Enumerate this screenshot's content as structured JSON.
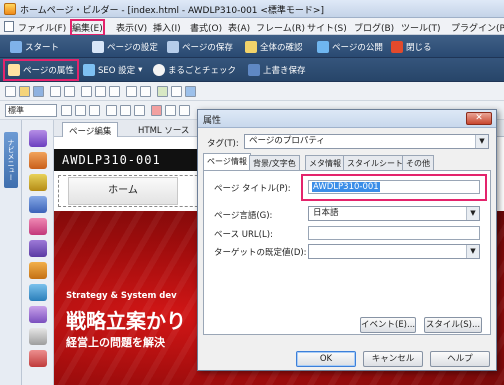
{
  "window": {
    "title": "ホームページ・ビルダー - [index.html - AWDLP310-001 <標準モード>]"
  },
  "menubar": {
    "items": [
      "ファイル(F)",
      "編集(E)",
      "表示(V)",
      "挿入(I)",
      "書式(O)",
      "表(A)",
      "フレーム(R)",
      "サイト(S)",
      "ブログ(B)",
      "ツール(T)",
      "プラグイン(P)"
    ]
  },
  "toolbar_main": {
    "start": "スタート",
    "page_settings": "ページの設定",
    "save_page": "ページの保存",
    "check_all": "全体の確認",
    "publish": "ページの公開",
    "close": "閉じる"
  },
  "toolbar_second": {
    "page_props": "ページの属性",
    "seo": "SEO 設定",
    "full_check": "まるごとチェック",
    "overwrite_save": "上書き保存"
  },
  "format_bar": {
    "style_value": "標準"
  },
  "left_panel": {
    "vertical_tab": "ナビメニュー"
  },
  "editor": {
    "tabs": [
      "ページ編集",
      "HTML ソース"
    ]
  },
  "page": {
    "logo": "AWDLP310-001",
    "nav_home": "ホーム",
    "hero_sub": "Strategy & System dev",
    "hero_main": "戦略立案かり",
    "hero_lead": "経営上の問題を解決"
  },
  "dialog": {
    "title": "属性",
    "close_glyph": "✕",
    "tag_label": "タグ(T):",
    "tag_value": "ページのプロパティ",
    "tabs": [
      "ページ情報",
      "背景/文字色",
      "メタ情報",
      "スタイルシート",
      "その他"
    ],
    "fields": {
      "page_title_label": "ページ タイトル(P):",
      "page_title_value": "AWDLP310-001",
      "language_label": "ページ言語(G):",
      "language_value": "日本語",
      "base_url_label": "ベース URL(L):",
      "base_url_value": "",
      "target_label": "ターゲットの既定値(D):",
      "target_value": ""
    },
    "event_button": "イベント(E)...",
    "style_button": "スタイル(S)...",
    "ok_button": "OK",
    "cancel_button": "キャンセル",
    "help_button": "ヘルプ"
  },
  "colors": {
    "highlight": "#e4246c",
    "toolbar": "#2a4a72",
    "hero_red": "#b00f0f",
    "selection": "#3b8ee8"
  }
}
